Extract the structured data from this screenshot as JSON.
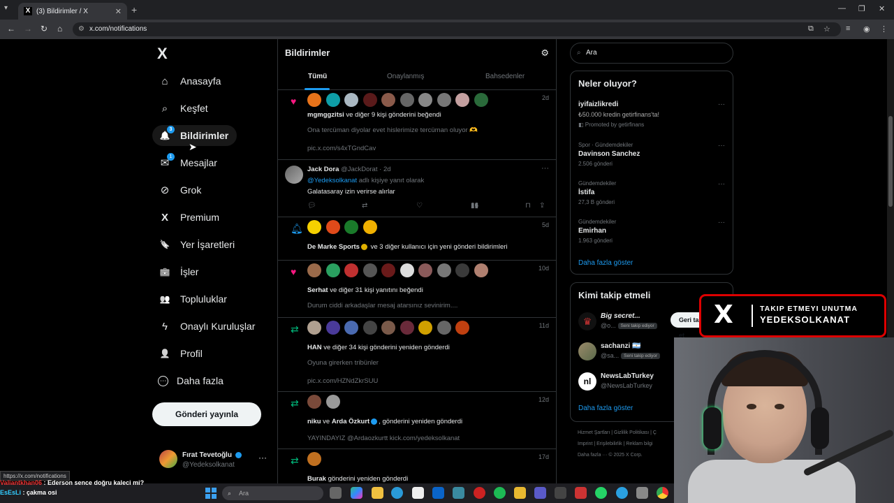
{
  "browser": {
    "tab_title": "(3) Bildirimler / X",
    "tab_favicon": "X",
    "tab_close": "✕",
    "new_tab": "+",
    "url": "x.com/notifications",
    "status_url": "https://x.com/notifications"
  },
  "nav": {
    "logo": "X",
    "items": [
      {
        "label": "Anasayfa",
        "icon": "home-icon",
        "glyph": "⌂"
      },
      {
        "label": "Keşfet",
        "icon": "search-icon",
        "glyph": "⌕"
      },
      {
        "label": "Bildirimler",
        "icon": "bell-icon",
        "glyph": "🔔",
        "badge": "3"
      },
      {
        "label": "Mesajlar",
        "icon": "mail-icon",
        "glyph": "✉",
        "badge": "1"
      },
      {
        "label": "Grok",
        "icon": "grok-icon",
        "glyph": "⊘"
      },
      {
        "label": "Premium",
        "icon": "x-premium-icon",
        "glyph": "X"
      },
      {
        "label": "Yer İşaretleri",
        "icon": "bookmark-icon",
        "glyph": "🔖"
      },
      {
        "label": "İşler",
        "icon": "briefcase-icon",
        "glyph": "💼"
      },
      {
        "label": "Topluluklar",
        "icon": "communities-icon",
        "glyph": "👥"
      },
      {
        "label": "Onaylı Kuruluşlar",
        "icon": "lightning-icon",
        "glyph": "ϟ"
      },
      {
        "label": "Profil",
        "icon": "person-icon",
        "glyph": "👤"
      },
      {
        "label": "Daha fazla",
        "icon": "more-circle-icon",
        "glyph": "⋯"
      }
    ],
    "post_button": "Gönderi yayınla",
    "account": {
      "name": "Fırat Tevetoğlu",
      "handle": "@Yedeksolkanat",
      "more": "···"
    }
  },
  "main": {
    "title": "Bildirimler",
    "tabs": [
      "Tümü",
      "Onaylanmış",
      "Bahsedenler"
    ],
    "notifications": [
      {
        "type": "like",
        "time": "2d",
        "actor": "mgmggzitsi",
        "text": " ve diğer 9 kişi gönderini beğendi",
        "quote": "Ona tercüman diyolar evet hislerimize tercüman oluyor 🫶",
        "link": "pic.x.com/s4xTGndCav"
      },
      {
        "type": "reply",
        "name": "Jack Dora",
        "handle": "@JackDorat",
        "time": "2d",
        "reply_to": "@Yedeksolkanat",
        "reply_suffix": " adlı kişiye yanıt olarak",
        "body": "Galatasaray izin verirse alırlar",
        "views": "16"
      },
      {
        "type": "new_posts",
        "time": "5d",
        "actor": "De Marke Sports",
        "text": " ve 3 diğer kullanıcı için yeni gönderi bildirimleri"
      },
      {
        "type": "like",
        "time": "10d",
        "actor": "Serhat",
        "text": " ve diğer 31 kişi yanıtını beğendi",
        "quote": "Durum ciddi arkadaşlar mesaj atarsınız sevinirim...."
      },
      {
        "type": "repost",
        "time": "11d",
        "actor": "HAN",
        "text": " ve diğer 34 kişi gönderini yeniden gönderdi",
        "quote": "Oyuna girerken tribünler",
        "link": "pic.x.com/HZNdZkrSUU"
      },
      {
        "type": "repost",
        "time": "12d",
        "actor": "niku",
        "actor2": "Arda Özkurt",
        "text": ", gönderini yeniden gönderdi",
        "quote": "YAYINDAYIZ @Ardaozkurtt  kick.com/yedeksolkanat"
      },
      {
        "type": "repost",
        "time": "17d",
        "actor": "Burak",
        "text": " gönderini yeniden gönderdi"
      }
    ]
  },
  "right": {
    "search_placeholder": "Ara",
    "trends_title": "Neler oluyor?",
    "trends": [
      {
        "category": "",
        "name": "iyifaizlikredi",
        "count": "₺50.000 kredin getirfinans'ta!",
        "promoted": "Promoted by getirfinans"
      },
      {
        "category": "Spor · Gündemdekiler",
        "name": "Davinson Sanchez",
        "count": "2.506 gönderi"
      },
      {
        "category": "Gündemdekiler",
        "name": "İstifa",
        "count": "27,3 B gönderi"
      },
      {
        "category": "Gündemdekiler",
        "name": "Emirhan",
        "count": "1.963 gönderi"
      }
    ],
    "trends_more": "Daha fazla göster",
    "who_title": "Kimi takip etmeli",
    "who": [
      {
        "name": "Big secret...",
        "handle": "@o...",
        "pill": "Seni takip ediyor"
      },
      {
        "name": "sachanzi 🇦🇷",
        "handle": "@sa...",
        "pill": "Seni takip ediyor"
      },
      {
        "name": "NewsLabTurkey",
        "handle": "@NewsLabTurkey",
        "pill": ""
      }
    ],
    "follow_back": "Geri takip et",
    "who_more": "Daha fazla göster",
    "footer_line1": "Hizmet Şartları  |  Gizlilik Politikası  |  Ç",
    "footer_line2": "Imprint  |  Erişilebilirlik  |  Reklam bilgi",
    "footer_line3": "Daha fazla ···  © 2025 X Corp."
  },
  "overlay": {
    "banner_logo": "X",
    "banner_line1": "TAKIP ETMEYI UNUTMA",
    "banner_line2": "YEDEKSOLKANAT"
  },
  "chat": [
    {
      "user": "Valiantkhan06",
      "message": " : Ederson sence doğru kaleci mi?"
    },
    {
      "user": "EsEsLi",
      "message": " : çakma osi"
    }
  ],
  "taskbar": {
    "search_placeholder": "Ara"
  }
}
